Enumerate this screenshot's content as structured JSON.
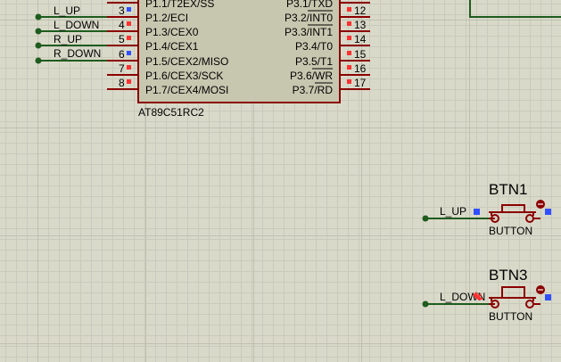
{
  "chip": {
    "name": "AT89C51RC2",
    "left_pins": [
      {
        "number": "3",
        "label": "P1.2/ECI"
      },
      {
        "number": "4",
        "label": "P1.3/CEX0"
      },
      {
        "number": "5",
        "label": "P1.4/CEX1"
      },
      {
        "number": "6",
        "label": "P1.5/CEX2/MISO"
      },
      {
        "number": "7",
        "label": "P1.6/CEX3/SCK"
      },
      {
        "number": "8",
        "label": "P1.7/CEX4/MOSI"
      }
    ],
    "left_top_partial": "P1.1/T2EX/SS",
    "right_pins": [
      {
        "number": "12",
        "label": "P3.2/INT0"
      },
      {
        "number": "13",
        "label": "P3.3/INT1"
      },
      {
        "number": "14",
        "label": "P3.4/T0"
      },
      {
        "number": "15",
        "label": "P3.5/T1"
      },
      {
        "number": "16",
        "label": "P3.6/WR"
      },
      {
        "number": "17",
        "label": "P3.7/RD"
      }
    ],
    "right_top_partial": "P3.1/TXD"
  },
  "nets": {
    "l_up": "L_UP",
    "l_down": "L_DOWN",
    "r_up": "R_UP",
    "r_down": "R_DOWN"
  },
  "buttons": [
    {
      "ref": "BTN1",
      "value": "BUTTON",
      "net": "L_UP"
    },
    {
      "ref": "BTN3",
      "value": "BUTTON",
      "net": "L_DOWN"
    }
  ],
  "colors": {
    "component_outline": "#8b0000",
    "chip_fill": "#c7c7b0",
    "wire": "#1e5c1e",
    "pin_marker": "#ff3030",
    "connection_marker": "#3050ff"
  }
}
